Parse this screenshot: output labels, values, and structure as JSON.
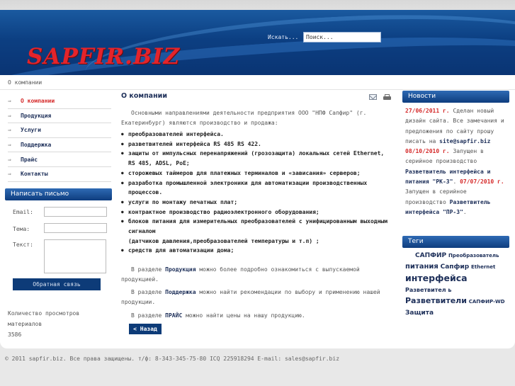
{
  "header": {
    "logo": "SAPFIR.BIZ",
    "search_label": "Искать...",
    "search_value": "Поиск..."
  },
  "breadcrumb": "О компании",
  "menu": {
    "items": [
      {
        "label": "О компании"
      },
      {
        "label": "Продукция"
      },
      {
        "label": "Услуги"
      },
      {
        "label": "Поддержка"
      },
      {
        "label": "Прайс"
      },
      {
        "label": "Контакты"
      }
    ]
  },
  "contact_form": {
    "title": "Написать письмо",
    "email_label": "Email:",
    "subject_label": "Тема:",
    "text_label": "Текст:",
    "submit_label": "Обратная связь"
  },
  "views": {
    "label": "Количество просмотров материалов",
    "count": "3586"
  },
  "article": {
    "title": "О компании",
    "intro": "Основными направлениями деятельности предприятия ООО \"НПФ Сапфир\" (г. Екатеринбург) являются производство и продажа:",
    "bullets": [
      "преобразователей интерфейса.",
      "разветвителей интерфейса RS 485 RS 422.",
      "защиты от импульсных перенапряжений (грозозащита) локальных сетей Ethernet, RS 485, ADSL, PoE;",
      "сторожевых таймеров для платежных терминалов и «зависания» серверов;",
      "разработка промышленной электроники для автоматизации производственных процессов.",
      "услуги по монтажу печатных плат;",
      "контрактное производство радиоэлектронного оборудования;",
      "блоков питания для измерительных преобразователей с унифицированным выходным сигналом"
    ],
    "bullet_cont": "(датчиков давления,преобразователей температуры и т.п) ;",
    "bullet_last": "средств для автоматизации дома;",
    "p1_a": "В разделе ",
    "p1_link": "Продукция",
    "p1_b": " можно более подробно ознакомиться с выпускаемой продукцией.",
    "p2_a": "В разделе ",
    "p2_link": "Поддержка",
    "p2_b": " можно найти рекомендации по выбору и применению нашей продукции.",
    "p3_a": "В разделе ",
    "p3_link": "ПРАЙС",
    "p3_b": " можно найти цены на нашу продукцию.",
    "back_label": "< Назад"
  },
  "news": {
    "title": "Новости",
    "n1_date": "27/06/2011 г.",
    "n1_text": " Сделан новый дизайн сайта. Все замечания и предложения по сайту прошу писать на ",
    "n1_email": "site@sapfir.biz",
    "n2_date": "08/10/2010 г.",
    "n2_text": " Запущен в серийное производство ",
    "n2_link": "Разветвитель интерфейса и питания \"РК-3\"",
    "n3_date": "07/07/2010 г.",
    "n3_text": " Запущен в серийное производство ",
    "n3_link": "Разветвитель интерфейса \"ПР-3\""
  },
  "tags": {
    "title": "Теги",
    "items": [
      "САПФИР",
      "Преобразователь",
      "питания",
      "Сапфир",
      "Ethernet",
      "интерфейса",
      "Разветвител ь",
      "Разветвители",
      "САПФИР-WD",
      "Защита"
    ]
  },
  "footer": "© 2011 sapfir.biz. Все права защищены. т/ф: 8-343-345-75-80 ICQ 225918294 E-mail: sales@sapfir.biz"
}
